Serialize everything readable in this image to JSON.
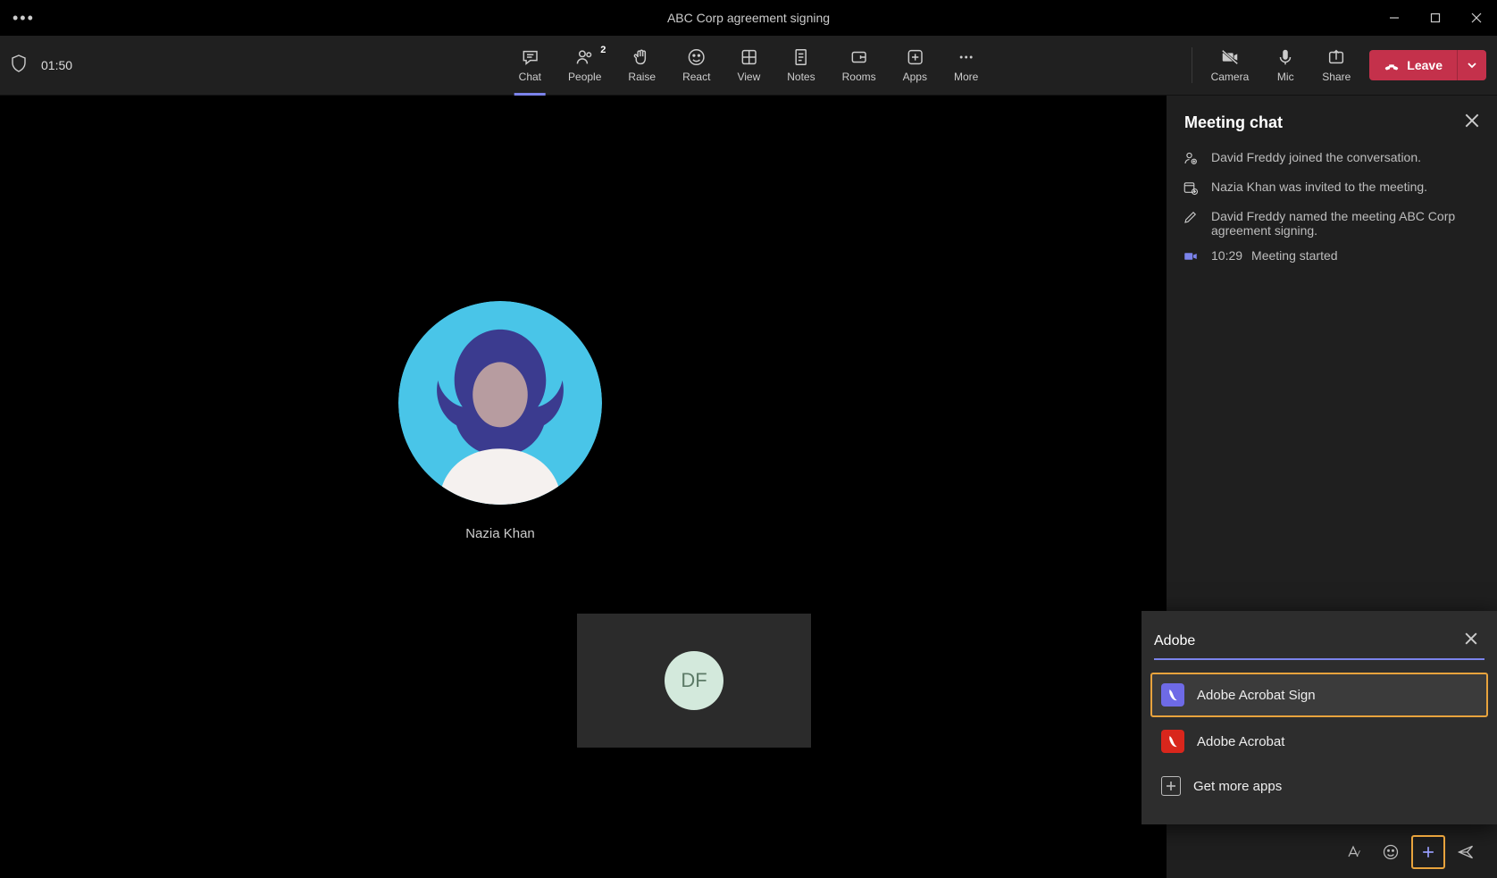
{
  "title": "ABC Corp agreement signing",
  "timer": "01:50",
  "toolbar": {
    "chat": "Chat",
    "people": "People",
    "people_count": "2",
    "raise": "Raise",
    "react": "React",
    "view": "View",
    "notes": "Notes",
    "rooms": "Rooms",
    "apps": "Apps",
    "more": "More",
    "camera": "Camera",
    "mic": "Mic",
    "share": "Share",
    "leave": "Leave"
  },
  "stage": {
    "main_participant": "Nazia Khan",
    "self_initials": "DF"
  },
  "side": {
    "title": "Meeting chat",
    "events": [
      {
        "icon": "person-add",
        "text": "David Freddy joined the conversation."
      },
      {
        "icon": "calendar-add",
        "text": "Nazia Khan was invited to the meeting."
      },
      {
        "icon": "pencil",
        "text": "David Freddy named the meeting ABC Corp agreement signing."
      },
      {
        "icon": "video",
        "time": "10:29",
        "text": "Meeting started"
      }
    ]
  },
  "search": {
    "value": "Adobe",
    "results": [
      {
        "label": "Adobe Acrobat Sign",
        "icon": "acrobat",
        "color": "purple",
        "highlight": true
      },
      {
        "label": "Adobe Acrobat",
        "icon": "acrobat",
        "color": "red",
        "highlight": false
      },
      {
        "label": "Get more apps",
        "icon": "plus",
        "color": "plain",
        "highlight": false
      }
    ]
  }
}
